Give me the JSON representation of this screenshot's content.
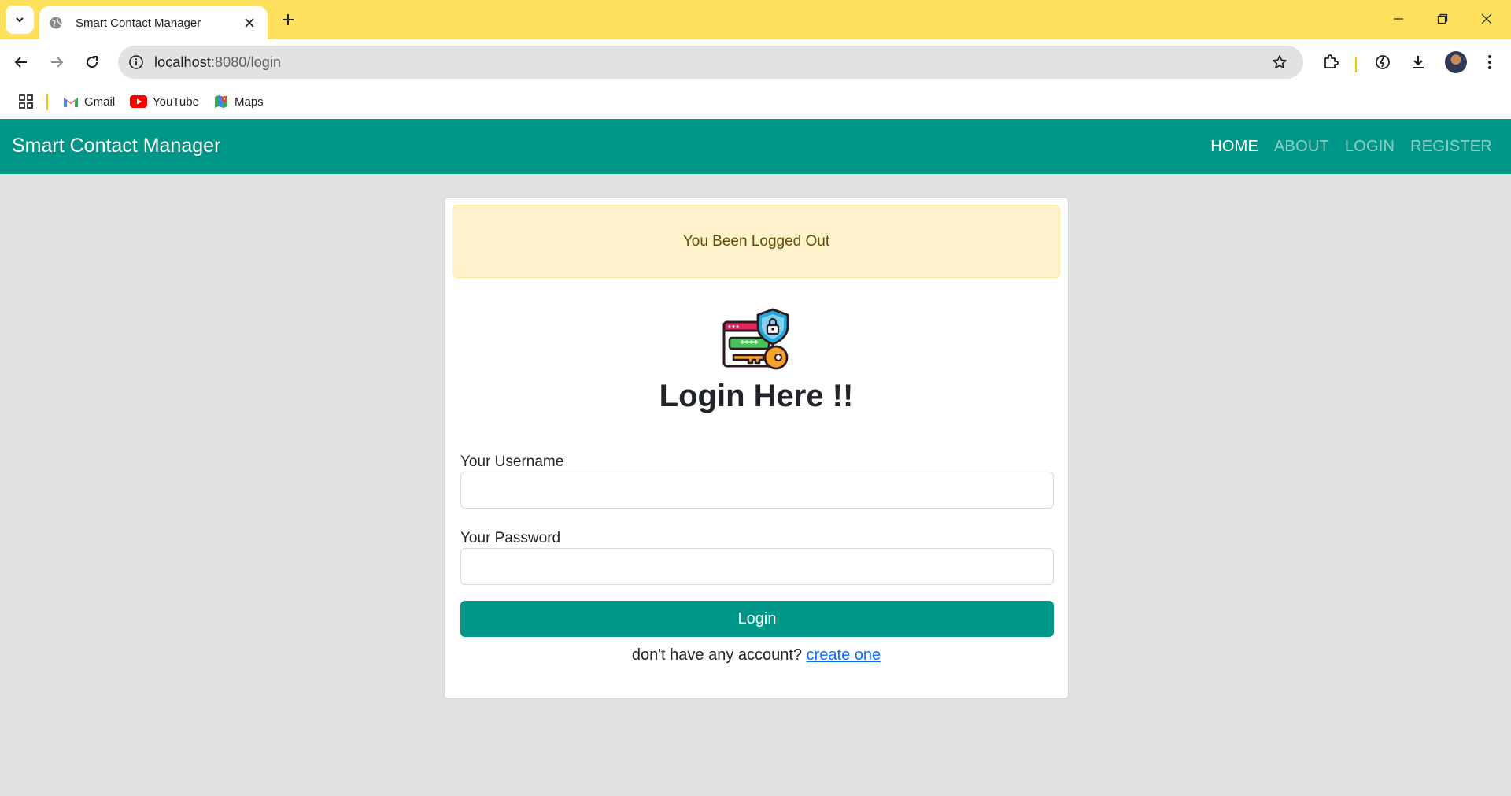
{
  "browser": {
    "tab_title": "Smart Contact Manager",
    "url_host": "localhost",
    "url_path": ":8080/login",
    "bookmarks": [
      {
        "label": "Gmail",
        "icon": "gmail-icon"
      },
      {
        "label": "YouTube",
        "icon": "youtube-icon"
      },
      {
        "label": "Maps",
        "icon": "maps-icon"
      }
    ],
    "accent": "#ffe05c"
  },
  "navbar": {
    "brand": "Smart Contact Manager",
    "links": [
      "HOME",
      "ABOUT",
      "LOGIN",
      "REGISTER"
    ],
    "active_link": "HOME",
    "color": "#009688"
  },
  "alert": {
    "message": "You Been Logged Out"
  },
  "login": {
    "logo_icon": "password-key-lock-icon",
    "heading": "Login Here !!",
    "username_label": "Your Username",
    "username_value": "",
    "password_label": "Your Password",
    "password_value": "",
    "submit_label": "Login",
    "signup_prompt": "don't have any account?",
    "signup_link": "create one"
  }
}
